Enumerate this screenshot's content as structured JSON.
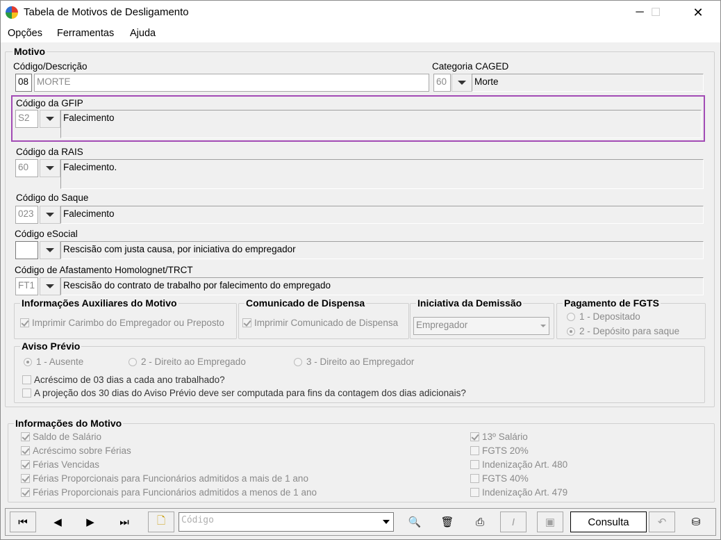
{
  "window": {
    "title": "Tabela de Motivos de Desligamento",
    "minimize": "─",
    "maximize": "☐",
    "close": "✕"
  },
  "menu": [
    "Opções",
    "Ferramentas",
    "Ajuda"
  ],
  "motivo": {
    "group_title": "Motivo",
    "codigo_label": "Código/Descrição",
    "codigo": "08",
    "descricao": "MORTE",
    "caged_label": "Categoria CAGED",
    "caged_code": "60",
    "caged_desc": "Morte",
    "gfip_label": "Código da GFIP",
    "gfip_code": "S2",
    "gfip_desc": "Falecimento",
    "rais_label": "Código da RAIS",
    "rais_code": "60",
    "rais_desc": "Falecimento.",
    "saque_label": "Código do Saque",
    "saque_code": "023",
    "saque_desc": "Falecimento",
    "esocial_label": "Código eSocial",
    "esocial_code": "",
    "esocial_desc": "Rescisão com justa causa, por iniciativa do empregador",
    "homolog_label": "Código de Afastamento Homolognet/TRCT",
    "homolog_code": "FT1",
    "homolog_desc": "Rescisão do contrato de trabalho por falecimento do empregado"
  },
  "aux": {
    "title": "Informações Auxiliares do Motivo",
    "check": "Imprimir Carimbo do Empregador ou Preposto"
  },
  "comunicado": {
    "title": "Comunicado de Dispensa",
    "check": "Imprimir Comunicado de Dispensa"
  },
  "iniciativa": {
    "title": "Iniciativa da Demissão",
    "value": "Empregador"
  },
  "fgts_pag": {
    "title": "Pagamento de FGTS",
    "opt1": "1 - Depositado",
    "opt2": "2 - Depósito para saque"
  },
  "aviso": {
    "title": "Aviso Prévio",
    "opt1": "1 - Ausente",
    "opt2": "2 - Direito ao Empregado",
    "opt3": "3 - Direito ao Empregador",
    "check1": "Acréscimo de 03 dias a cada ano trabalhado?",
    "check2": "A projeção dos 30 dias do Aviso Prévio deve ser computada para fins da contagem dos dias adicionais?"
  },
  "info": {
    "title": "Informações do Motivo",
    "left": [
      {
        "label": "Saldo de Salário",
        "checked": true
      },
      {
        "label": "Acréscimo sobre Férias",
        "checked": true
      },
      {
        "label": "Férias Vencidas",
        "checked": true
      },
      {
        "label": "Férias Proporcionais para Funcionários admitidos a mais de 1 ano",
        "checked": true
      },
      {
        "label": "Férias Proporcionais para Funcionários admitidos a menos de 1 ano",
        "checked": true
      }
    ],
    "right": [
      {
        "label": "13º Salário",
        "checked": true
      },
      {
        "label": "FGTS 20%",
        "checked": false
      },
      {
        "label": "Indenização Art. 480",
        "checked": false
      },
      {
        "label": "FGTS 40%",
        "checked": false
      },
      {
        "label": "Indenização Art. 479",
        "checked": false
      }
    ]
  },
  "toolbar": {
    "search_placeholder": "Código",
    "consulta": "Consulta"
  },
  "colors": {
    "highlight": "#a24bb5",
    "disabled_text": "#8a8a8a"
  }
}
